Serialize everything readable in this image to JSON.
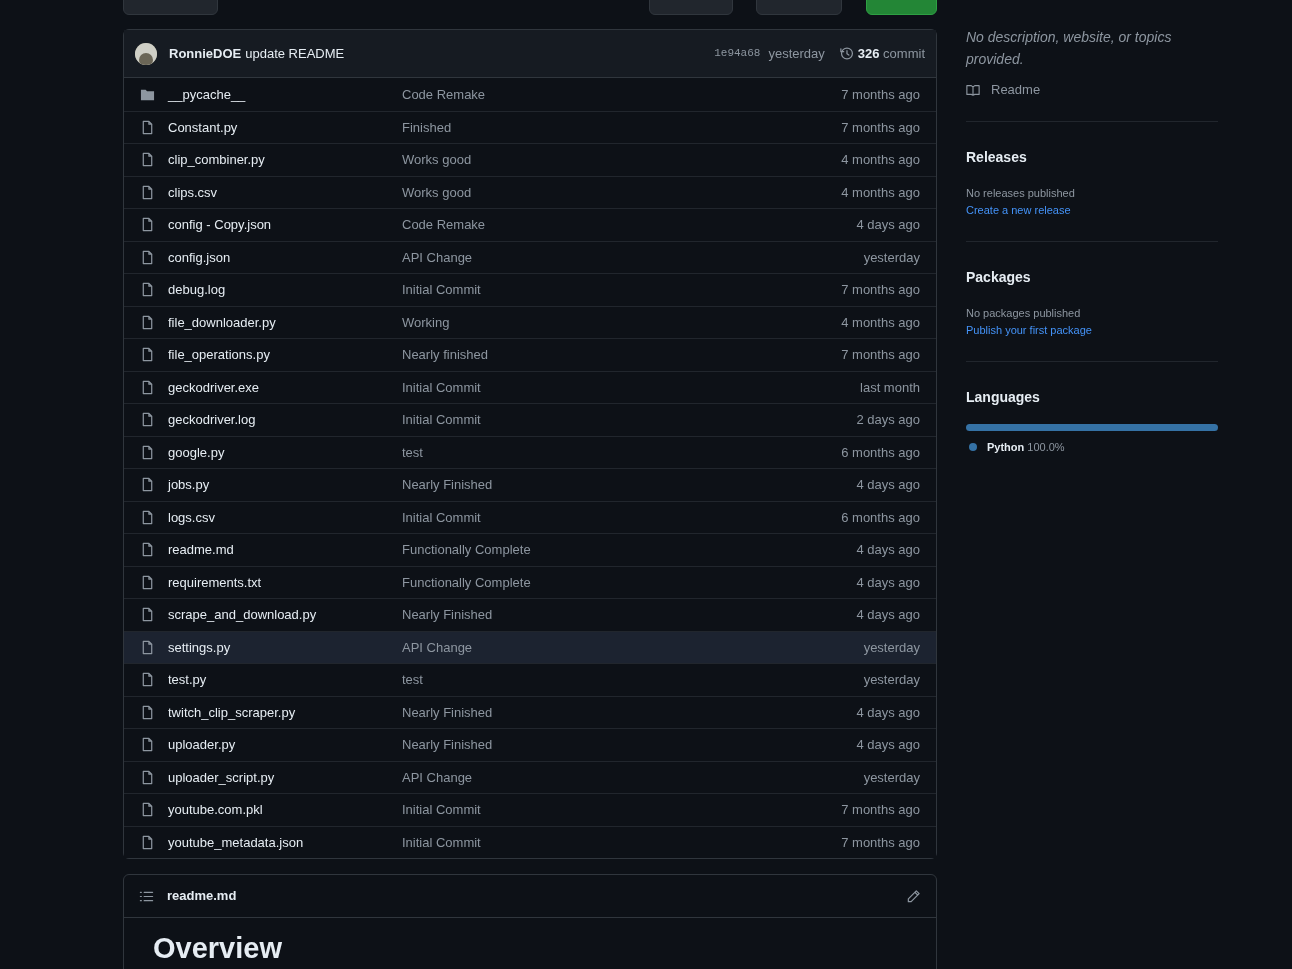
{
  "toolbar": {
    "buttons": [
      {
        "kind": "branch"
      },
      {
        "kind": "plain"
      },
      {
        "kind": "dropdown"
      },
      {
        "kind": "primary"
      }
    ]
  },
  "commit": {
    "author": "RonnieDOE",
    "message": "update README",
    "hash": "1e94a68",
    "time": "yesterday",
    "count": "326",
    "count_label": "commit"
  },
  "files": [
    {
      "kind": "folder",
      "name": "__pycache__",
      "message": "Code Remake",
      "time": "7 months ago",
      "highlighted": false
    },
    {
      "kind": "file",
      "name": "Constant.py",
      "message": "Finished",
      "time": "7 months ago",
      "highlighted": false
    },
    {
      "kind": "file",
      "name": "clip_combiner.py",
      "message": "Works good",
      "time": "4 months ago",
      "highlighted": false
    },
    {
      "kind": "file",
      "name": "clips.csv",
      "message": "Works good",
      "time": "4 months ago",
      "highlighted": false
    },
    {
      "kind": "file",
      "name": "config - Copy.json",
      "message": "Code Remake",
      "time": "4 days ago",
      "highlighted": false
    },
    {
      "kind": "file",
      "name": "config.json",
      "message": "API Change",
      "time": "yesterday",
      "highlighted": false
    },
    {
      "kind": "file",
      "name": "debug.log",
      "message": "Initial Commit",
      "time": "7 months ago",
      "highlighted": false
    },
    {
      "kind": "file",
      "name": "file_downloader.py",
      "message": "Working",
      "time": "4 months ago",
      "highlighted": false
    },
    {
      "kind": "file",
      "name": "file_operations.py",
      "message": "Nearly finished",
      "time": "7 months ago",
      "highlighted": false
    },
    {
      "kind": "file",
      "name": "geckodriver.exe",
      "message": "Initial Commit",
      "time": "last month",
      "highlighted": false
    },
    {
      "kind": "file",
      "name": "geckodriver.log",
      "message": "Initial Commit",
      "time": "2 days ago",
      "highlighted": false
    },
    {
      "kind": "file",
      "name": "google.py",
      "message": "test",
      "time": "6 months ago",
      "highlighted": false
    },
    {
      "kind": "file",
      "name": "jobs.py",
      "message": "Nearly Finished",
      "time": "4 days ago",
      "highlighted": false
    },
    {
      "kind": "file",
      "name": "logs.csv",
      "message": "Initial Commit",
      "time": "6 months ago",
      "highlighted": false
    },
    {
      "kind": "file",
      "name": "readme.md",
      "message": "Functionally Complete",
      "time": "4 days ago",
      "highlighted": false
    },
    {
      "kind": "file",
      "name": "requirements.txt",
      "message": "Functionally Complete",
      "time": "4 days ago",
      "highlighted": false
    },
    {
      "kind": "file",
      "name": "scrape_and_download.py",
      "message": "Nearly Finished",
      "time": "4 days ago",
      "highlighted": false
    },
    {
      "kind": "file",
      "name": "settings.py",
      "message": "API Change",
      "time": "yesterday",
      "highlighted": true
    },
    {
      "kind": "file",
      "name": "test.py",
      "message": "test",
      "time": "yesterday",
      "highlighted": false
    },
    {
      "kind": "file",
      "name": "twitch_clip_scraper.py",
      "message": "Nearly Finished",
      "time": "4 days ago",
      "highlighted": false
    },
    {
      "kind": "file",
      "name": "uploader.py",
      "message": "Nearly Finished",
      "time": "4 days ago",
      "highlighted": false
    },
    {
      "kind": "file",
      "name": "uploader_script.py",
      "message": "API Change",
      "time": "yesterday",
      "highlighted": false
    },
    {
      "kind": "file",
      "name": "youtube.com.pkl",
      "message": "Initial Commit",
      "time": "7 months ago",
      "highlighted": false
    },
    {
      "kind": "file",
      "name": "youtube_metadata.json",
      "message": "Initial Commit",
      "time": "7 months ago",
      "highlighted": false
    }
  ],
  "readme": {
    "filename": "readme.md",
    "heading": "Overview"
  },
  "sidebar": {
    "about": {
      "description": "No description, website, or topics provided.",
      "readme_link": "Readme"
    },
    "releases": {
      "title": "Releases",
      "note": "No releases published",
      "link": "Create a new release"
    },
    "packages": {
      "title": "Packages",
      "note": "No packages published",
      "link": "Publish your first package"
    },
    "languages": {
      "title": "Languages",
      "items": [
        {
          "name": "Python",
          "percent": "100.0%",
          "level": 1.0,
          "color": "#3572a5"
        }
      ]
    }
  }
}
